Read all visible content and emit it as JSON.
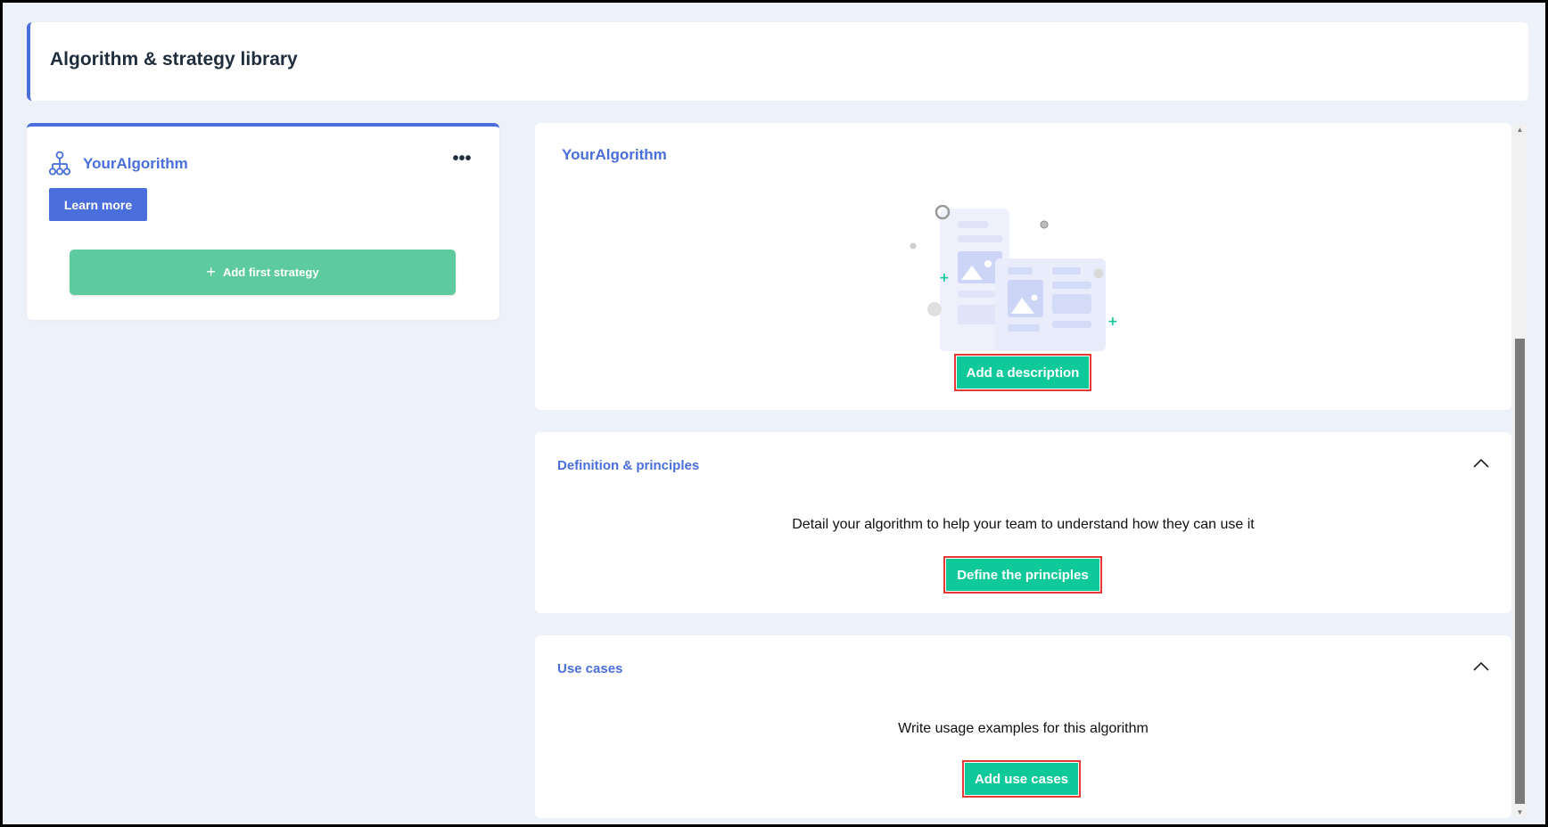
{
  "header": {
    "title": "Algorithm & strategy library"
  },
  "left_panel": {
    "algorithm_name": "YourAlgorithm",
    "more_label": "•••",
    "learn_more_label": "Learn more",
    "add_strategy_plus": "+",
    "add_strategy_label": "Add first strategy",
    "icon": "hierarchy-icon"
  },
  "description_card": {
    "title": "YourAlgorithm",
    "button_label": "Add a description"
  },
  "definition_card": {
    "title": "Definition & principles",
    "text": "Detail your algorithm to help your team to understand how they can use it",
    "button_label": "Define the principles"
  },
  "use_cases_card": {
    "title": "Use cases",
    "text": "Write usage examples for this algorithm",
    "button_label": "Add use cases"
  },
  "scrollbar": {
    "up": "▲",
    "down": "▼"
  },
  "colors": {
    "accent_blue": "#4a6fdc",
    "primary_green": "#10c99a",
    "strategy_green": "#5ecb9f",
    "background": "#edf1f9",
    "highlight_red": "#e53935"
  }
}
